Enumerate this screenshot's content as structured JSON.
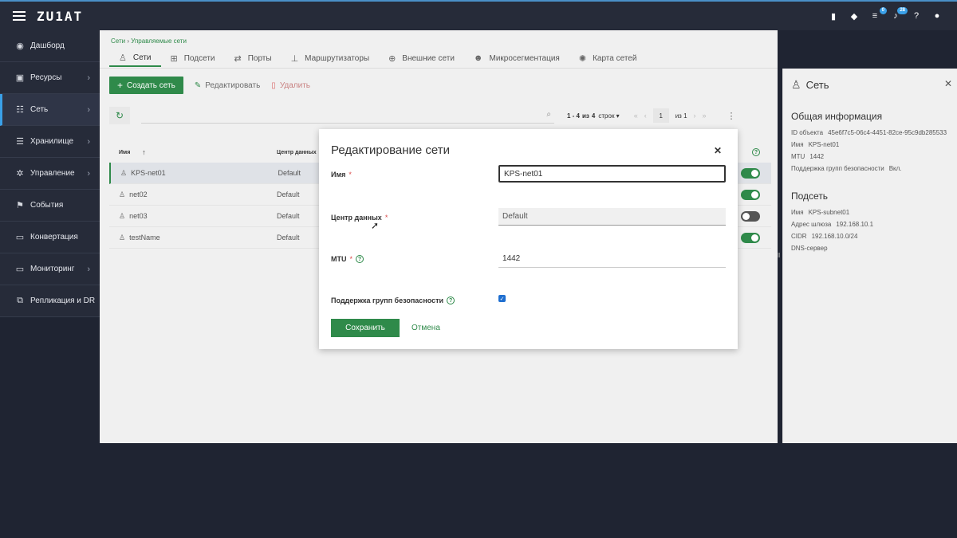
{
  "brand": {
    "logo": "ZU1AT"
  },
  "topbar": {
    "icons": [
      {
        "name": "bookmark-icon",
        "glyph": "▮"
      },
      {
        "name": "tag-icon",
        "glyph": "◆"
      },
      {
        "name": "tasks-icon",
        "glyph": "≡",
        "badge": "0"
      },
      {
        "name": "bell-icon",
        "glyph": "♪",
        "badge": "28"
      },
      {
        "name": "help-icon",
        "glyph": "?"
      },
      {
        "name": "user-icon",
        "glyph": "●"
      }
    ]
  },
  "sidebar": {
    "items": [
      {
        "label": "Дашборд",
        "icon": "dashboard-icon",
        "glyph": "◉",
        "has_chevron": false
      },
      {
        "label": "Ресурсы",
        "icon": "resources-icon",
        "glyph": "▣",
        "has_chevron": true
      },
      {
        "label": "Сеть",
        "icon": "network-icon",
        "glyph": "☷",
        "has_chevron": true,
        "active": true
      },
      {
        "label": "Хранилище",
        "icon": "storage-icon",
        "glyph": "☰",
        "has_chevron": true
      },
      {
        "label": "Управление",
        "icon": "settings-icon",
        "glyph": "✲",
        "has_chevron": true
      },
      {
        "label": "События",
        "icon": "flag-icon",
        "glyph": "⚑",
        "has_chevron": false
      },
      {
        "label": "Конвертация",
        "icon": "convert-icon",
        "glyph": "▭",
        "has_chevron": false
      },
      {
        "label": "Мониторинг",
        "icon": "monitor-icon",
        "glyph": "▭",
        "has_chevron": true
      },
      {
        "label": "Репликация и DR",
        "icon": "replication-icon",
        "glyph": "⧉",
        "has_chevron": false
      }
    ]
  },
  "breadcrumb": {
    "root": "Сети",
    "separator": "›",
    "current": "Управляемые сети"
  },
  "tabs": [
    {
      "label": "Сети",
      "icon": "network-tree-icon",
      "glyph": "♙",
      "active": true
    },
    {
      "label": "Подсети",
      "icon": "subnet-icon",
      "glyph": "⊞"
    },
    {
      "label": "Порты",
      "icon": "ports-icon",
      "glyph": "⇄"
    },
    {
      "label": "Маршрутизаторы",
      "icon": "router-icon",
      "glyph": "⊥"
    },
    {
      "label": "Внешние сети",
      "icon": "globe-icon",
      "glyph": "⊕"
    },
    {
      "label": "Микросегментация",
      "icon": "group-icon",
      "glyph": "☻"
    },
    {
      "label": "Карта сетей",
      "icon": "network-map-icon",
      "glyph": "✺"
    }
  ],
  "toolbar": {
    "create": "Создать сеть",
    "edit": "Редактировать",
    "delete": "Удалить"
  },
  "pager": {
    "range": "1 - 4",
    "of_label": "из",
    "total": "4",
    "rows_label": "строк",
    "page": "1",
    "page_of": "из 1"
  },
  "table": {
    "headers": {
      "name": "Имя",
      "sort": "↑",
      "dc": "Центр данных"
    },
    "rows": [
      {
        "name": "KPS-net01",
        "dc": "Default",
        "sg": true,
        "selected": true
      },
      {
        "name": "net02",
        "dc": "Default",
        "sg": true
      },
      {
        "name": "net03",
        "dc": "Default",
        "sg": false
      },
      {
        "name": "testName",
        "dc": "Default",
        "sg": true
      }
    ]
  },
  "right_panel": {
    "title": "Сеть",
    "general_heading": "Общая информация",
    "id_label": "ID объекта",
    "id_value": "45e6f7c5-06c4-4451-82ce-95c9db285533",
    "name_label": "Имя",
    "name_value": "KPS-net01",
    "mtu_label": "MTU",
    "mtu_value": "1442",
    "sg_label": "Поддержка групп безопасности",
    "sg_value": "Вкл.",
    "subnet_heading": "Подсеть",
    "subnet_name_label": "Имя",
    "subnet_name_value": "KPS-subnet01",
    "gateway_label": "Адрес шлюза",
    "gateway_value": "192.168.10.1",
    "cidr_label": "CIDR",
    "cidr_value": "192.168.10.0/24",
    "dns_label": "DNS-сервер"
  },
  "modal": {
    "title": "Редактирование сети",
    "name_label": "Имя",
    "name_value": "KPS-net01",
    "dc_label": "Центр данных",
    "dc_value": "Default",
    "mtu_label": "MTU",
    "mtu_value": "1442",
    "sg_label": "Поддержка групп безопасности",
    "sg_checked": true,
    "required_mark": "*",
    "help": "?",
    "save": "Сохранить",
    "cancel": "Отмена"
  },
  "colors": {
    "accent": "#2f8a4a",
    "sidebar_bg": "#262b39",
    "active_marker": "#3aa0e8",
    "danger": "#d96666"
  }
}
